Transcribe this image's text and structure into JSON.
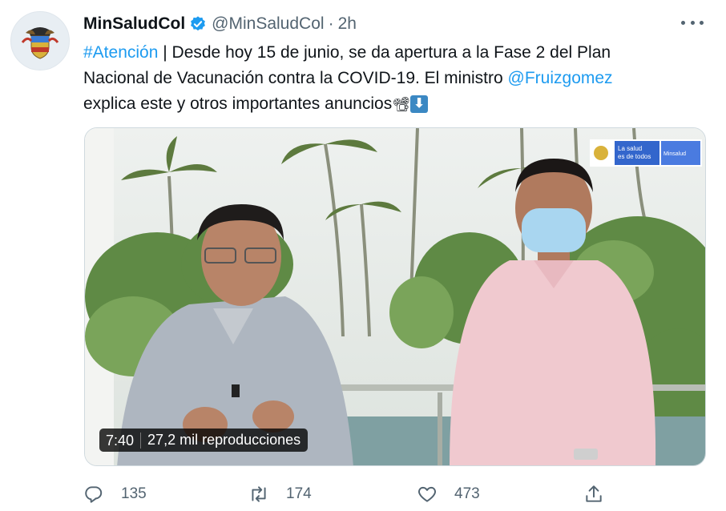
{
  "tweet": {
    "display_name": "MinSaludCol",
    "handle": "@MinSaludCol",
    "separator": "·",
    "time": "2h",
    "text": {
      "hashtag": "#Atención",
      "line1_rest": " | Desde hoy 15 de junio, se da apertura a la Fase 2 del Plan",
      "line2_start": "Nacional de Vacunación contra la COVID-19. El ministro ",
      "mention": "@Fruizgomez",
      "line3": "explica este y otros importantes anuncios",
      "emoji_camera": "📽",
      "emoji_down": "⬇"
    }
  },
  "media": {
    "duration": "7:40",
    "views": "27,2 mil reproducciones",
    "logo_text_line1": "La salud",
    "logo_text_line2": "es de todos",
    "logo_ministry": "Minsalud"
  },
  "actions": {
    "replies": "135",
    "retweets": "174",
    "likes": "473"
  },
  "colors": {
    "accent": "#1d9bf0",
    "muted": "#536471",
    "verified": "#1d9bf0"
  }
}
